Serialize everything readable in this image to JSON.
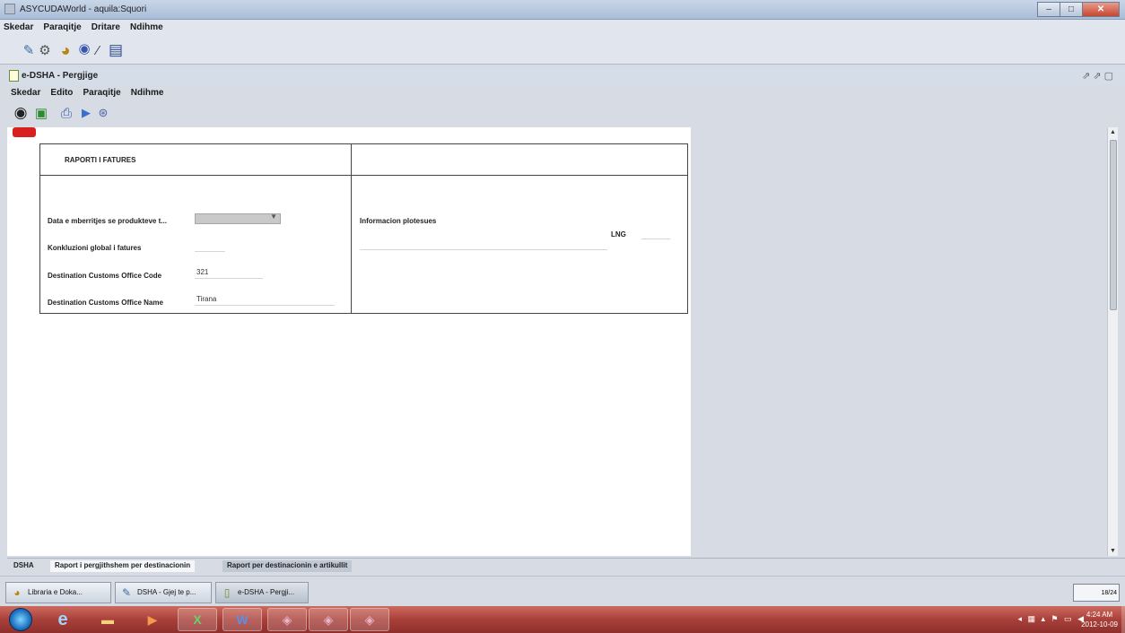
{
  "outer_window": {
    "title": "ASYCUDAWorld - aquila:Squori",
    "menu": [
      "Skedar",
      "Paraqitje",
      "Dritare",
      "Ndihme"
    ]
  },
  "inner_window": {
    "title": "e-DSHA - Pergjige",
    "menu": [
      "Skedar",
      "Edito",
      "Paraqitje",
      "Ndihme"
    ]
  },
  "form": {
    "section_title": "RAPORTI I FATURES",
    "fields": [
      {
        "label": "Data e mberritjes se produkteve t...",
        "value": ""
      },
      {
        "label": "Konkluzioni global i fatures",
        "value": ""
      },
      {
        "label": "Destination Customs Office Code",
        "value": "321"
      },
      {
        "label": "Destination Customs Office Name",
        "value": "Tirana"
      }
    ],
    "info_label": "Informacion plotesues",
    "lng_label": "LNG"
  },
  "bottom_tabs": [
    "DSHA",
    "Raport i pergjithshem per destinacionin",
    "Raport per destinacionin e artikullit"
  ],
  "internal_taskbar": {
    "items": [
      {
        "label": "Libraria e Doka..."
      },
      {
        "label": "DSHA - Gjej te p..."
      },
      {
        "label": "e-DSHA - Pergji..."
      }
    ],
    "memory": "18/24"
  },
  "system_tray": {
    "time": "4:24 AM",
    "date": "2012-10-09"
  },
  "colors": {
    "window_bg": "#d6dbe4",
    "taskbar": "#a9403a",
    "red_tab": "#d82020"
  }
}
